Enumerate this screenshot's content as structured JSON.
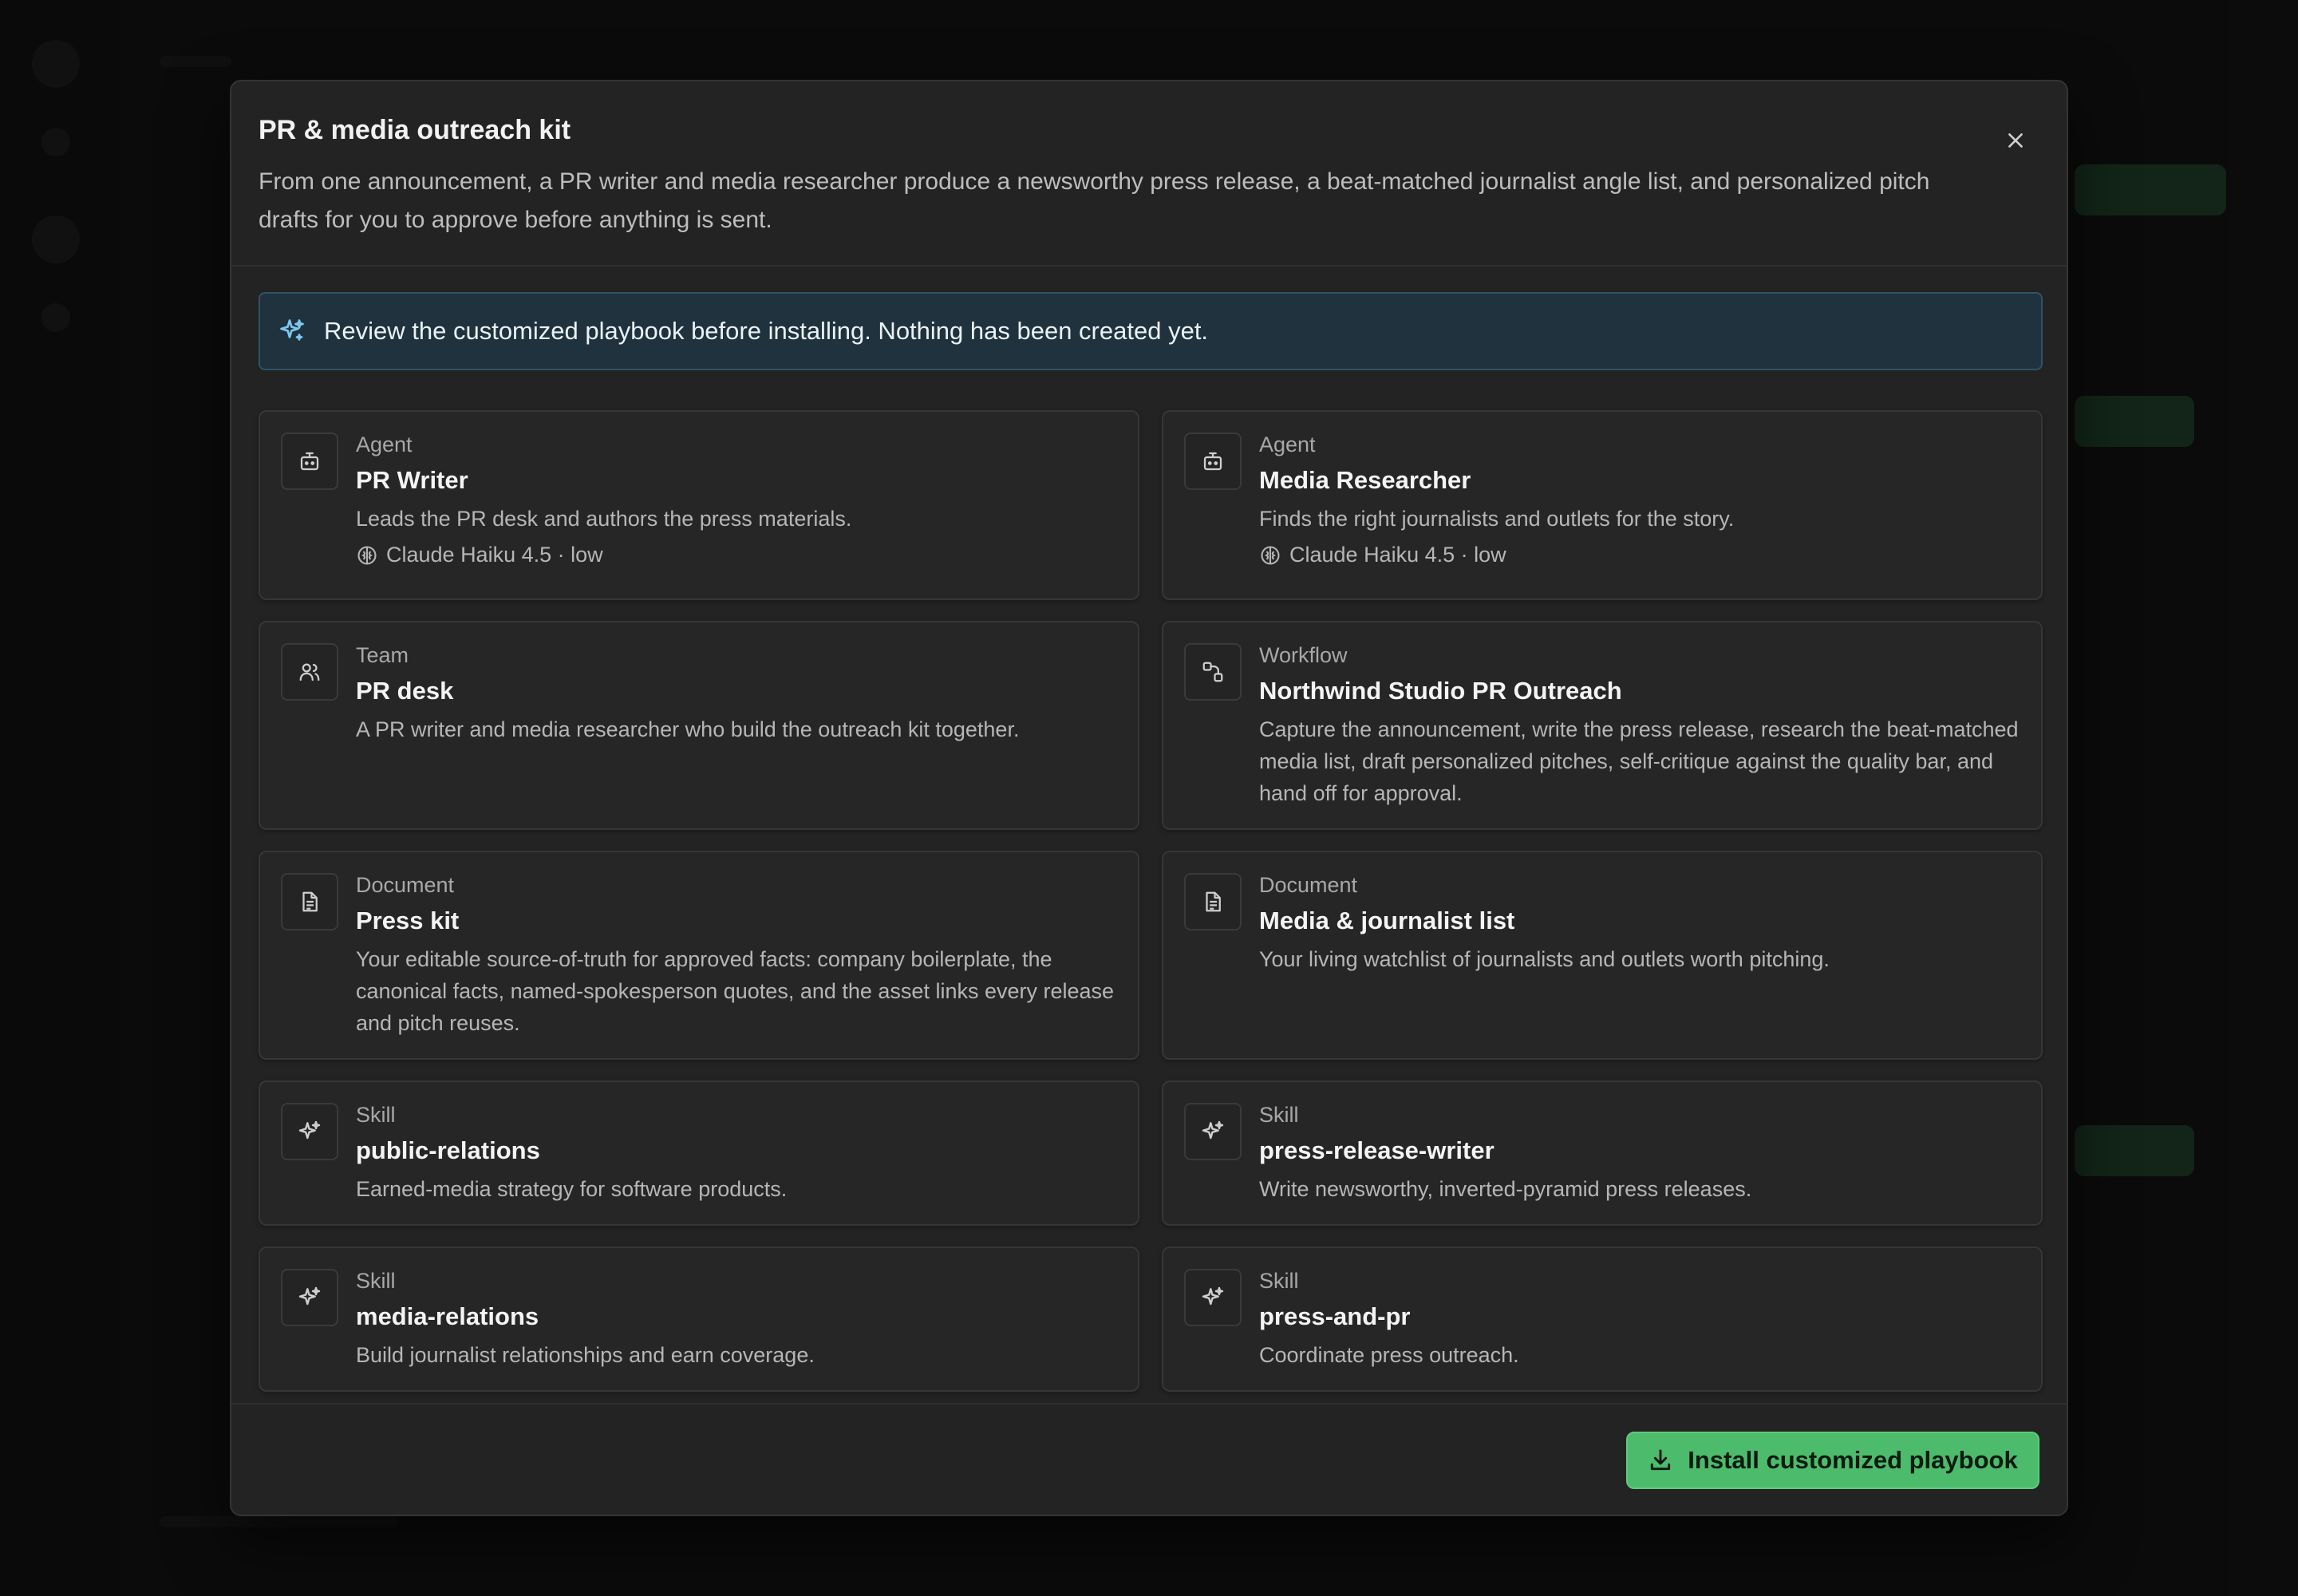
{
  "modal": {
    "title": "PR & media outreach kit",
    "description": "From one announcement, a PR writer and media researcher produce a newsworthy press release, a beat-matched journalist angle list, and personalized pitch drafts for you to approve before anything is sent.",
    "close_icon": "close-icon"
  },
  "notice": {
    "icon": "sparkles-icon",
    "text": "Review the customized playbook before installing. Nothing has been created yet."
  },
  "cards": [
    {
      "kind": "Agent",
      "name": "PR Writer",
      "description": "Leads the PR desk and authors the press materials.",
      "meta": "Claude Haiku 4.5 · low",
      "icon": "bot-icon"
    },
    {
      "kind": "Agent",
      "name": "Media Researcher",
      "description": "Finds the right journalists and outlets for the story.",
      "meta": "Claude Haiku 4.5 · low",
      "icon": "bot-icon"
    },
    {
      "kind": "Team",
      "name": "PR desk",
      "description": "A PR writer and media researcher who build the outreach kit together.",
      "icon": "users-icon"
    },
    {
      "kind": "Workflow",
      "name": "Northwind Studio PR Outreach",
      "description": "Capture the announcement, write the press release, research the beat-matched media list, draft personalized pitches, self-critique against the quality bar, and hand off for approval.",
      "icon": "workflow-icon"
    },
    {
      "kind": "Document",
      "name": "Press kit",
      "description": "Your editable source-of-truth for approved facts: company boilerplate, the canonical facts, named-spokesperson quotes, and the asset links every release and pitch reuses.",
      "icon": "document-icon"
    },
    {
      "kind": "Document",
      "name": "Media & journalist list",
      "description": "Your living watchlist of journalists and outlets worth pitching.",
      "icon": "document-icon"
    },
    {
      "kind": "Skill",
      "name": "public-relations",
      "description": "Earned-media strategy for software products.",
      "icon": "sparkles-icon"
    },
    {
      "kind": "Skill",
      "name": "press-release-writer",
      "description": "Write newsworthy, inverted-pyramid press releases.",
      "icon": "sparkles-icon"
    },
    {
      "kind": "Skill",
      "name": "media-relations",
      "description": "Build journalist relationships and earn coverage.",
      "icon": "sparkles-icon"
    },
    {
      "kind": "Skill",
      "name": "press-and-pr",
      "description": "Coordinate press outreach.",
      "icon": "sparkles-icon"
    }
  ],
  "footer": {
    "install_label": "Install customized playbook",
    "install_icon": "download-icon"
  },
  "colors": {
    "accent": "#4cbb6c",
    "notice_bg": "#20323d",
    "notice_icon": "#7cc8f0"
  }
}
